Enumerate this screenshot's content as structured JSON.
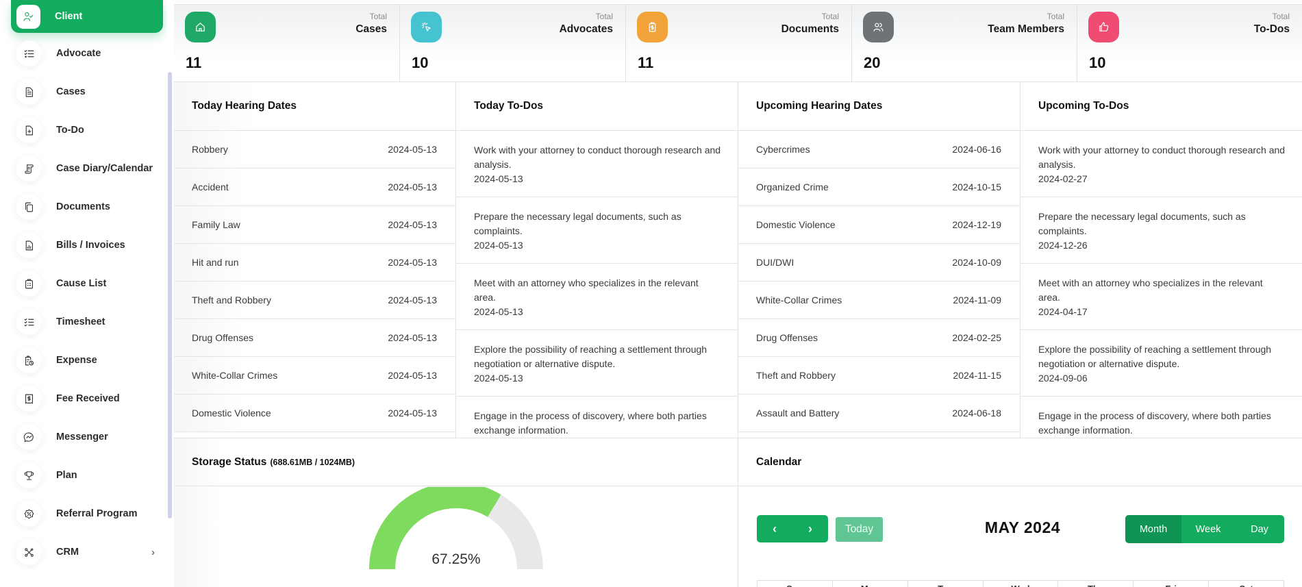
{
  "sidebar": {
    "items": [
      {
        "label": "Client",
        "icon": "user-check-icon",
        "active": true
      },
      {
        "label": "Advocate",
        "icon": "list-check-icon"
      },
      {
        "label": "Cases",
        "icon": "file-text-icon"
      },
      {
        "label": "To-Do",
        "icon": "file-plus-icon"
      },
      {
        "label": "Case Diary/Calendar",
        "icon": "scroll-icon"
      },
      {
        "label": "Documents",
        "icon": "copy-icon"
      },
      {
        "label": "Bills / Invoices",
        "icon": "file-chart-icon"
      },
      {
        "label": "Cause List",
        "icon": "clipboard-list-icon"
      },
      {
        "label": "Timesheet",
        "icon": "checklist-icon"
      },
      {
        "label": "Expense",
        "icon": "clipboard-clock-icon"
      },
      {
        "label": "Fee Received",
        "icon": "receipt-dollar-icon"
      },
      {
        "label": "Messenger",
        "icon": "messenger-icon"
      },
      {
        "label": "Plan",
        "icon": "trophy-icon"
      },
      {
        "label": "Referral Program",
        "icon": "discount-badge-icon"
      },
      {
        "label": "CRM",
        "icon": "crm-network-icon",
        "has_submenu": true
      }
    ]
  },
  "stats": [
    {
      "total_label": "Total",
      "label": "Cases",
      "value": "11",
      "icon": "home-icon",
      "color": "#20a866"
    },
    {
      "total_label": "Total",
      "label": "Advocates",
      "value": "10",
      "icon": "cursor-click-icon",
      "color": "#45c3d1"
    },
    {
      "total_label": "Total",
      "label": "Documents",
      "value": "11",
      "icon": "clipboard-dollar-icon",
      "color": "#f2a33a"
    },
    {
      "total_label": "Total",
      "label": "Team Members",
      "value": "20",
      "icon": "users-icon",
      "color": "#6e7378"
    },
    {
      "total_label": "Total",
      "label": "To-Dos",
      "value": "10",
      "icon": "thumbs-up-icon",
      "color": "#ef4b73"
    }
  ],
  "today_hearing": {
    "title": "Today Hearing Dates",
    "rows": [
      {
        "name": "Robbery",
        "date": "2024-05-13"
      },
      {
        "name": "Accident",
        "date": "2024-05-13"
      },
      {
        "name": "Family Law",
        "date": "2024-05-13"
      },
      {
        "name": "Hit and run",
        "date": "2024-05-13"
      },
      {
        "name": "Theft and Robbery",
        "date": "2024-05-13"
      },
      {
        "name": "Drug Offenses",
        "date": "2024-05-13"
      },
      {
        "name": "White-Collar Crimes",
        "date": "2024-05-13"
      },
      {
        "name": "Domestic Violence",
        "date": "2024-05-13"
      }
    ]
  },
  "today_todos": {
    "title": "Today To-Dos",
    "rows": [
      {
        "text": "Work with your attorney to conduct thorough research and analysis.",
        "date": "2024-05-13"
      },
      {
        "text": "Prepare the necessary legal documents, such as complaints.",
        "date": "2024-05-13"
      },
      {
        "text": "Meet with an attorney who specializes in the relevant area.",
        "date": "2024-05-13"
      },
      {
        "text": "Explore the possibility of reaching a settlement through negotiation or alternative dispute.",
        "date": "2024-05-13"
      },
      {
        "text": "Engage in the process of discovery, where both parties exchange information.",
        "date": ""
      }
    ]
  },
  "upcoming_hearing": {
    "title": "Upcoming Hearing Dates",
    "rows": [
      {
        "name": "Cybercrimes",
        "date": "2024-06-16"
      },
      {
        "name": "Organized Crime",
        "date": "2024-10-15"
      },
      {
        "name": "Domestic Violence",
        "date": "2024-12-19"
      },
      {
        "name": "DUI/DWI",
        "date": "2024-10-09"
      },
      {
        "name": "White-Collar Crimes",
        "date": "2024-11-09"
      },
      {
        "name": "Drug Offenses",
        "date": "2024-02-25"
      },
      {
        "name": "Theft and Robbery",
        "date": "2024-11-15"
      },
      {
        "name": "Assault and Battery",
        "date": "2024-06-18"
      }
    ]
  },
  "upcoming_todos": {
    "title": "Upcoming To-Dos",
    "rows": [
      {
        "text": "Work with your attorney to conduct thorough research and analysis.",
        "date": "2024-02-27"
      },
      {
        "text": "Prepare the necessary legal documents, such as complaints.",
        "date": "2024-12-26"
      },
      {
        "text": "Meet with an attorney who specializes in the relevant area.",
        "date": "2024-04-17"
      },
      {
        "text": "Explore the possibility of reaching a settlement through negotiation or alternative dispute.",
        "date": "2024-09-06"
      },
      {
        "text": "Engage in the process of discovery, where both parties exchange information.",
        "date": ""
      }
    ]
  },
  "storage": {
    "title": "Storage Status",
    "usage": "(688.61MB / 1024MB)",
    "percent_label": "67.25%",
    "percent": 67.25,
    "fill_color": "#7fdb5e",
    "track_color": "#e8e8e8"
  },
  "calendar": {
    "title": "Calendar",
    "prev_icon": "chevron-left-icon",
    "next_icon": "chevron-right-icon",
    "today_label": "Today",
    "month_title": "MAY 2024",
    "views": [
      {
        "label": "Month",
        "active": true
      },
      {
        "label": "Week",
        "active": false
      },
      {
        "label": "Day",
        "active": false
      }
    ],
    "weekdays": [
      "Sun",
      "Mon",
      "Tue",
      "Wed",
      "Thu",
      "Fri",
      "Sat"
    ]
  },
  "theme": {
    "accent": "#13ab5e",
    "scrollbar": "#cfd0ea"
  }
}
